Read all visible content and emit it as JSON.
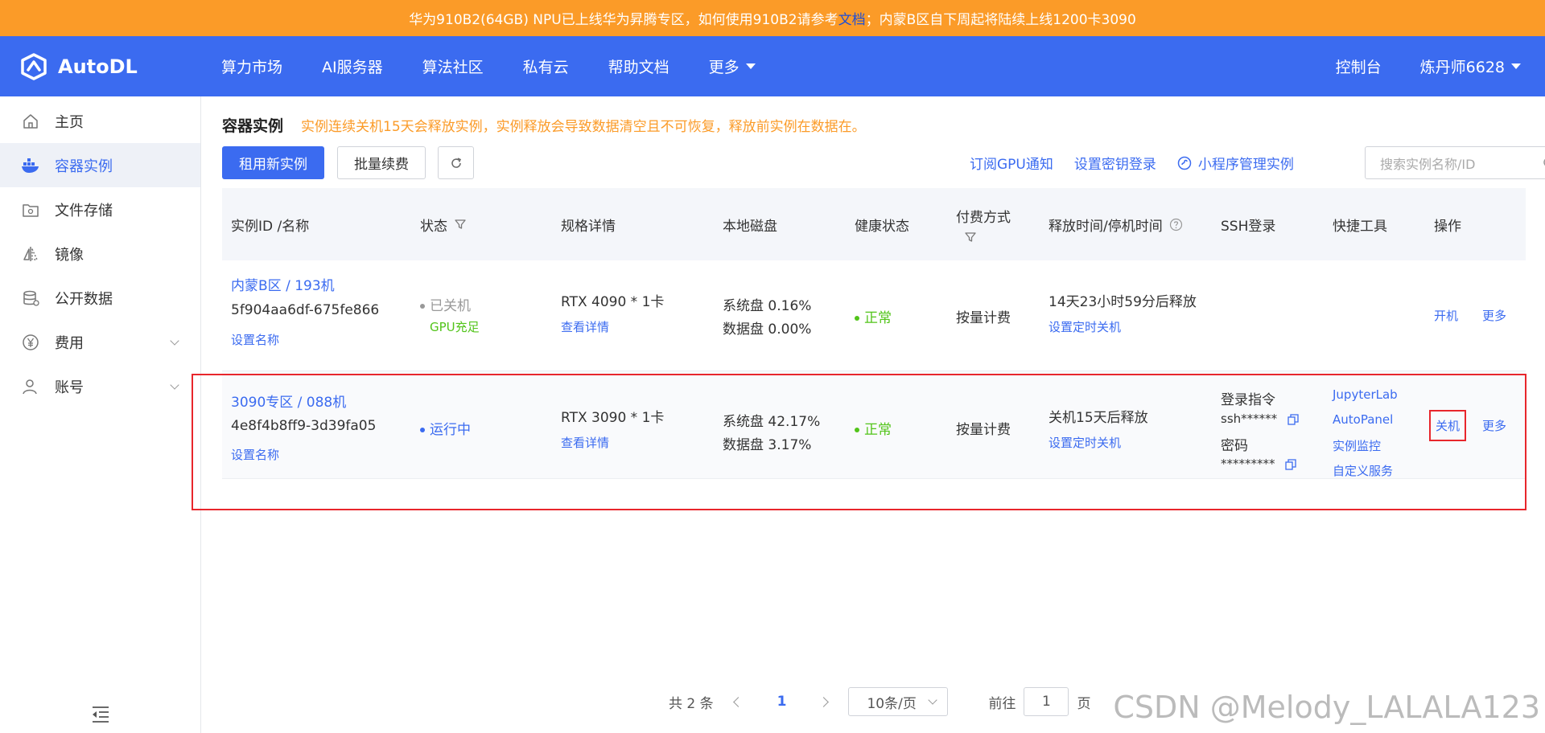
{
  "banner": {
    "text_before": "华为910B2(64GB) NPU已上线华为昇腾专区，如何使用910B2请参考",
    "link": "文档",
    "text_after": "；内蒙B区自下周起将陆续上线1200卡3090"
  },
  "topnav": {
    "logo": "AutoDL",
    "items": [
      "算力市场",
      "AI服务器",
      "算法社区",
      "私有云",
      "帮助文档",
      "更多"
    ],
    "console": "控制台",
    "user": "炼丹师6628"
  },
  "sidebar": {
    "items": [
      {
        "label": "主页",
        "icon": "home-icon"
      },
      {
        "label": "容器实例",
        "icon": "container-icon"
      },
      {
        "label": "文件存储",
        "icon": "folder-icon"
      },
      {
        "label": "镜像",
        "icon": "mirror-icon"
      },
      {
        "label": "公开数据",
        "icon": "database-icon"
      },
      {
        "label": "费用",
        "icon": "yen-icon"
      },
      {
        "label": "账号",
        "icon": "user-icon"
      }
    ],
    "active_index": 1
  },
  "page": {
    "title": "容器实例",
    "warning": "实例连续关机15天会释放实例，实例释放会导致数据清空且不可恢复，释放前实例在数据在。"
  },
  "toolbar": {
    "rent_button": "租用新实例",
    "renew_button": "批量续费",
    "links": [
      "订阅GPU通知",
      "设置密钥登录",
      "小程序管理实例"
    ],
    "search_placeholder": "搜索实例名称/ID"
  },
  "table": {
    "headers": {
      "id": "实例ID /名称",
      "status": "状态",
      "spec": "规格详情",
      "disk": "本地磁盘",
      "health": "健康状态",
      "billing_line1": "付费方式",
      "release": "释放时间/停机时间",
      "ssh": "SSH登录",
      "tools": "快捷工具",
      "ops": "操作"
    },
    "rows": [
      {
        "region": "内蒙B区 / 193机",
        "id": "5f904aa6df-675fe866",
        "set_name": "设置名称",
        "status": "已关机",
        "status_sub": "GPU充足",
        "gpu": "RTX 4090 * 1卡",
        "spec_link": "查看详情",
        "sys_disk": "系统盘 0.16%",
        "data_disk": "数据盘 0.00%",
        "health": "正常",
        "billing": "按量计费",
        "release": "14天23小时59分后释放",
        "release_link": "设置定时关机",
        "op_primary": "开机",
        "op_more": "更多"
      },
      {
        "region": "3090专区 / 088机",
        "id": "4e8f4b8ff9-3d39fa05",
        "set_name": "设置名称",
        "status": "运行中",
        "gpu": "RTX 3090 * 1卡",
        "spec_link": "查看详情",
        "sys_disk": "系统盘 42.17%",
        "data_disk": "数据盘 3.17%",
        "health": "正常",
        "billing": "按量计费",
        "release": "关机15天后释放",
        "release_link": "设置定时关机",
        "ssh_label": "登录指令",
        "ssh_cmd": "ssh******",
        "pwd_label": "密码",
        "pwd": "*********",
        "tools": [
          "JupyterLab",
          "AutoPanel",
          "实例监控",
          "自定义服务"
        ],
        "op_primary": "关机",
        "op_more": "更多"
      }
    ]
  },
  "pager": {
    "total": "共 2 条",
    "current": "1",
    "page_size": "10条/页",
    "goto_label": "前往",
    "goto_value": "1",
    "page_suffix": "页"
  },
  "watermark": "CSDN @Melody_LALALA123",
  "colors": {
    "primary": "#3b6bf0",
    "banner": "#fb9b28",
    "success": "#52c41a",
    "highlight": "#e8262c"
  }
}
